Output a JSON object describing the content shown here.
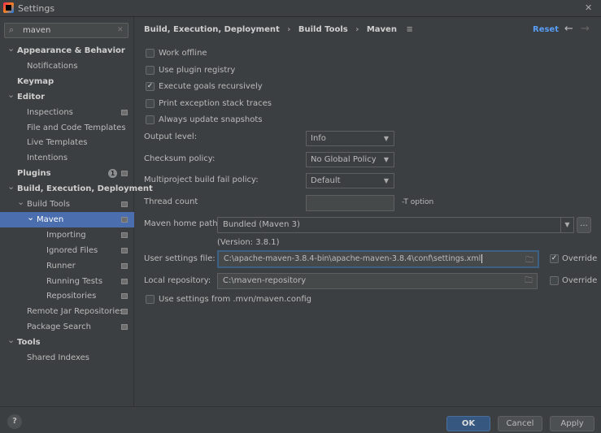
{
  "window": {
    "title": "Settings",
    "close": "✕"
  },
  "search": {
    "value": "maven",
    "icon": "search-icon",
    "clear": "✕"
  },
  "sidebar": {
    "items": [
      {
        "label": "Appearance & Behavior",
        "level": 0,
        "bold": true,
        "expanded": true
      },
      {
        "label": "Notifications",
        "level": 1
      },
      {
        "label": "Keymap",
        "level": 0,
        "bold": true
      },
      {
        "label": "Editor",
        "level": 0,
        "bold": true,
        "expanded": true
      },
      {
        "label": "Inspections",
        "level": 1,
        "page_icon": true
      },
      {
        "label": "File and Code Templates",
        "level": 1
      },
      {
        "label": "Live Templates",
        "level": 1
      },
      {
        "label": "Intentions",
        "level": 1
      },
      {
        "label": "Plugins",
        "level": 0,
        "bold": true,
        "badge": "1",
        "page_icon": true
      },
      {
        "label": "Build, Execution, Deployment",
        "level": 0,
        "bold": true,
        "expanded": true
      },
      {
        "label": "Build Tools",
        "level": 1,
        "expanded": true,
        "page_icon": true
      },
      {
        "label": "Maven",
        "level": 2,
        "expanded": true,
        "page_icon": true,
        "selected": true
      },
      {
        "label": "Importing",
        "level": 3,
        "page_icon": true
      },
      {
        "label": "Ignored Files",
        "level": 3,
        "page_icon": true
      },
      {
        "label": "Runner",
        "level": 3,
        "page_icon": true
      },
      {
        "label": "Running Tests",
        "level": 3,
        "page_icon": true
      },
      {
        "label": "Repositories",
        "level": 3,
        "page_icon": true
      },
      {
        "label": "Remote Jar Repositories",
        "level": 1,
        "page_icon": true
      },
      {
        "label": "Package Search",
        "level": 1,
        "page_icon": true
      },
      {
        "label": "Tools",
        "level": 0,
        "bold": true,
        "expanded": true
      },
      {
        "label": "Shared Indexes",
        "level": 1
      }
    ]
  },
  "breadcrumb": {
    "items": [
      "Build, Execution, Deployment",
      "Build Tools",
      "Maven"
    ],
    "sep": "›"
  },
  "header": {
    "reset": "Reset",
    "back": "←",
    "forward": "→",
    "accent": "#589df6"
  },
  "checkboxes": [
    {
      "label": "Work offline",
      "checked": false
    },
    {
      "label": "Use plugin registry",
      "checked": false
    },
    {
      "label": "Execute goals recursively",
      "checked": true
    },
    {
      "label": "Print exception stack traces",
      "checked": false
    },
    {
      "label": "Always update snapshots",
      "checked": false
    }
  ],
  "form": {
    "output_level": {
      "label": "Output level:",
      "value": "Info"
    },
    "checksum": {
      "label": "Checksum policy:",
      "value": "No Global Policy"
    },
    "fail_policy": {
      "label": "Multiproject build fail policy:",
      "value": "Default"
    },
    "thread": {
      "label": "Thread count",
      "value": "",
      "hint": "-T option"
    },
    "home": {
      "label": "Maven home path:",
      "value": "Bundled (Maven 3)",
      "browse": "...",
      "version": "(Version: 3.8.1)"
    },
    "user_settings": {
      "label": "User settings file:",
      "value": "C:\\apache-maven-3.8.4-bin\\apache-maven-3.8.4\\conf\\settings.xml",
      "override": "Override",
      "override_checked": true
    },
    "local_repo": {
      "label": "Local repository:",
      "value": "C:\\maven-repository",
      "override": "Override",
      "override_checked": false
    },
    "mvn_config": {
      "label": "Use settings from .mvn/maven.config",
      "checked": false
    }
  },
  "footer": {
    "help": "?",
    "ok": "OK",
    "cancel": "Cancel",
    "apply": "Apply",
    "primary_color": "#365880"
  }
}
